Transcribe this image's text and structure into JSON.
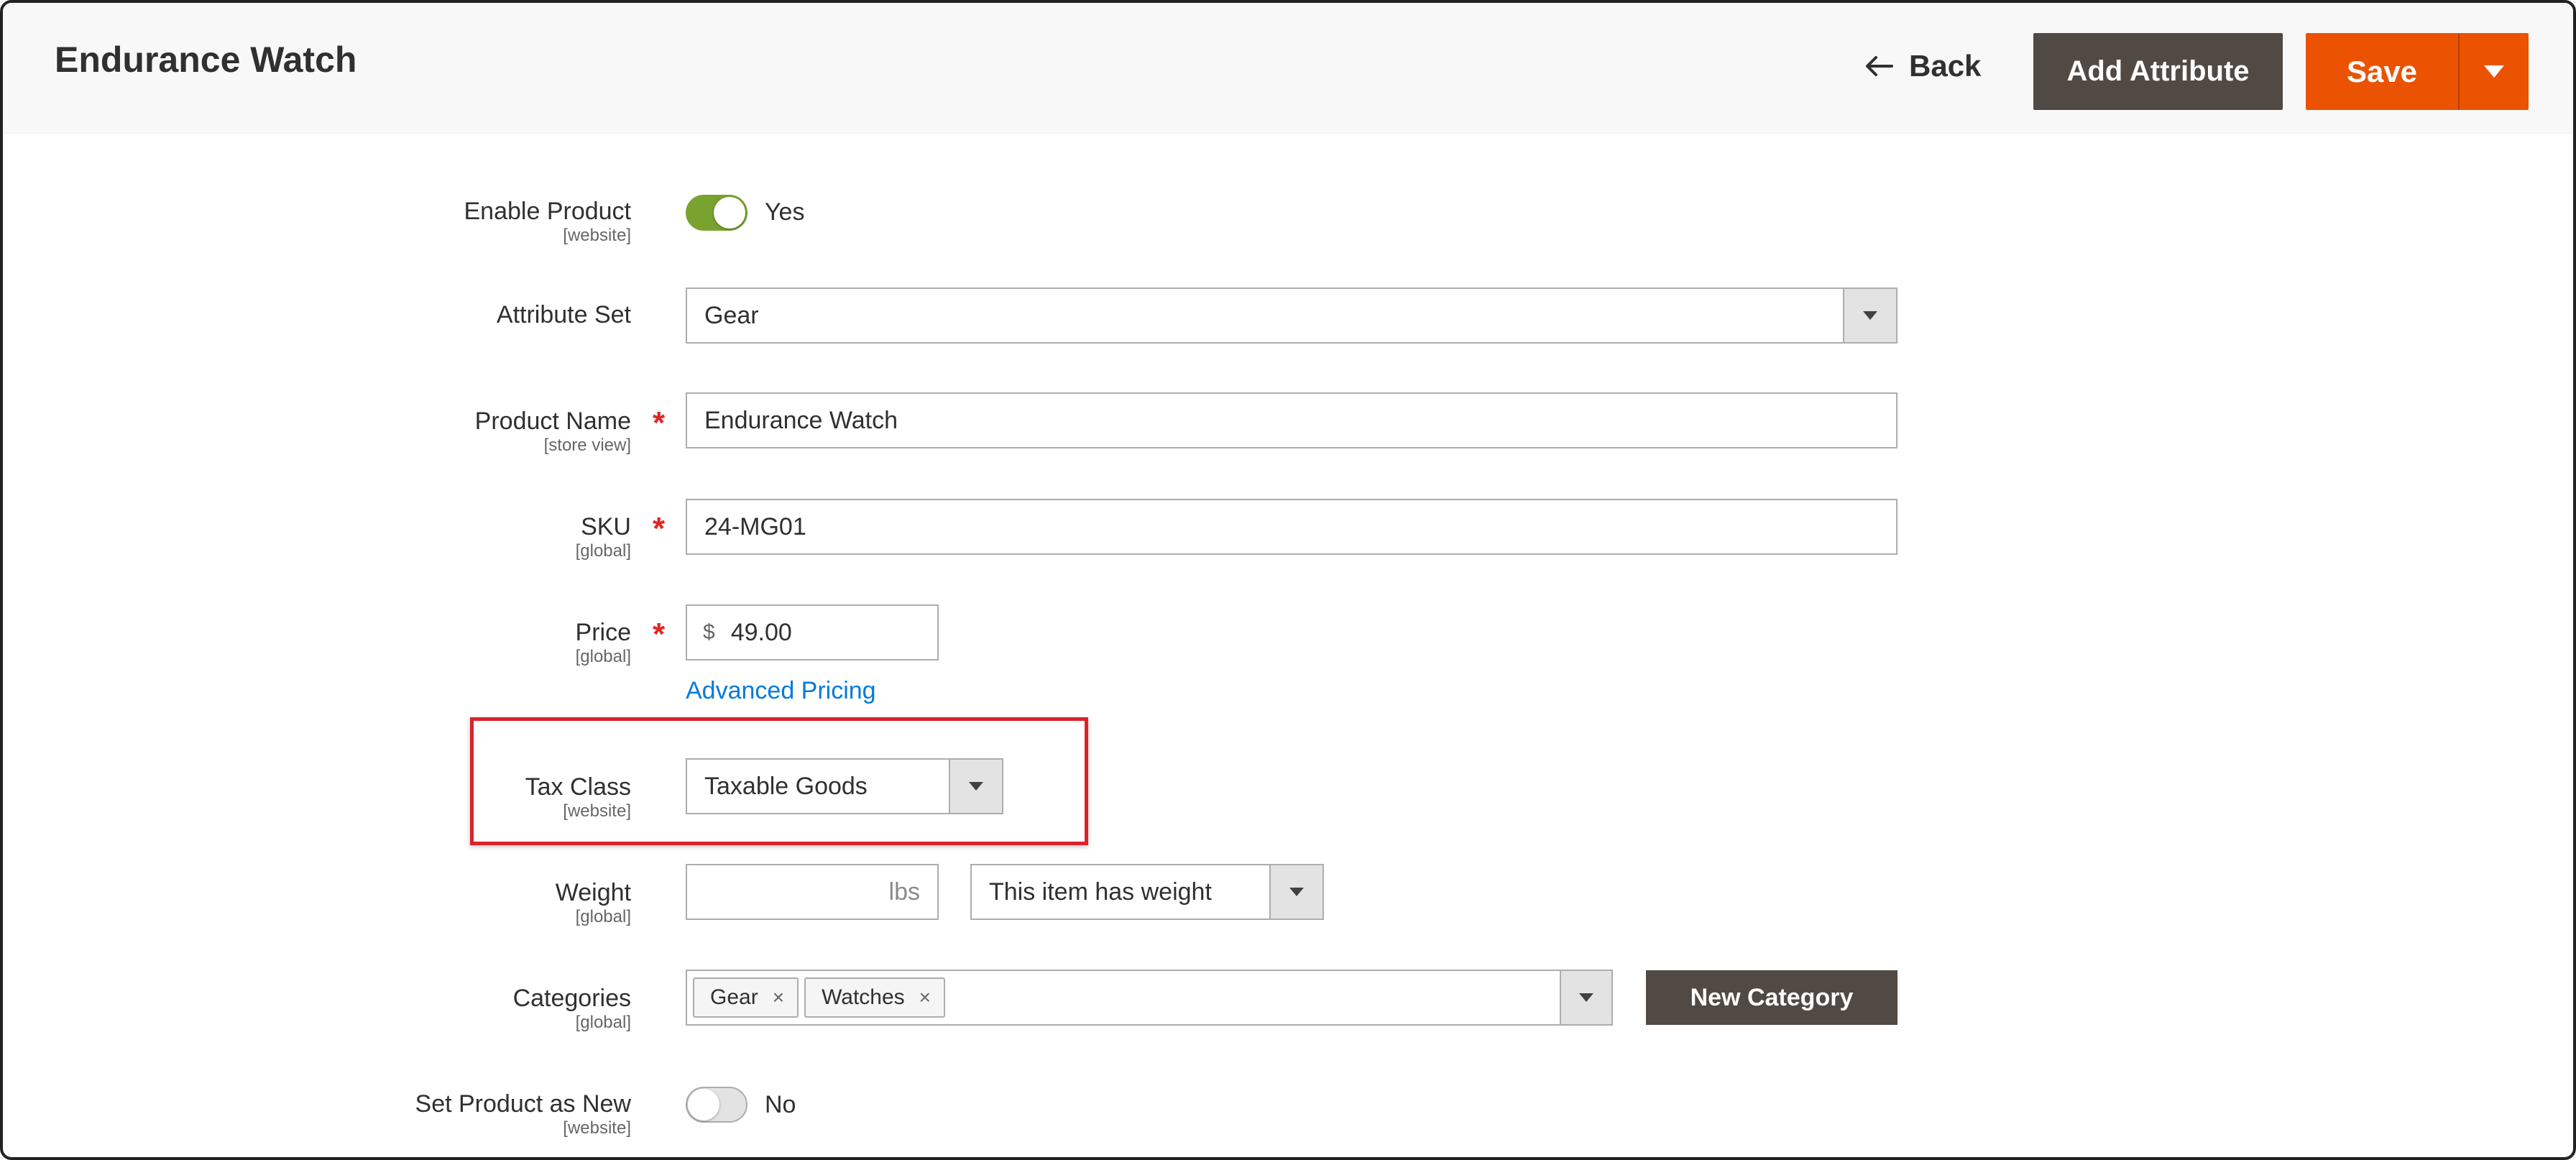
{
  "header": {
    "title": "Endurance Watch",
    "back_label": "Back",
    "add_attribute_label": "Add Attribute",
    "save_label": "Save"
  },
  "colors": {
    "primary_button": "#eb5202",
    "secondary_button": "#514943",
    "toggle_on": "#79a22e",
    "toggle_off": "#e3e3e3",
    "link": "#007bdb",
    "required": "#e22626",
    "highlight_border": "#d9232a"
  },
  "form": {
    "enable_product": {
      "label": "Enable Product",
      "scope": "[website]",
      "value": "Yes",
      "on": true
    },
    "attribute_set": {
      "label": "Attribute Set",
      "value": "Gear"
    },
    "product_name": {
      "label": "Product Name",
      "scope": "[store view]",
      "value": "Endurance Watch",
      "required": true
    },
    "sku": {
      "label": "SKU",
      "scope": "[global]",
      "value": "24-MG01",
      "required": true
    },
    "price": {
      "label": "Price",
      "scope": "[global]",
      "currency": "$",
      "value": "49.00",
      "required": true,
      "advanced_link": "Advanced Pricing"
    },
    "tax_class": {
      "label": "Tax Class",
      "scope": "[website]",
      "value": "Taxable Goods"
    },
    "weight": {
      "label": "Weight",
      "scope": "[global]",
      "unit": "lbs",
      "value": "",
      "type_value": "This item has weight"
    },
    "categories": {
      "label": "Categories",
      "scope": "[global]",
      "chips": [
        "Gear",
        "Watches"
      ],
      "new_button": "New Category"
    },
    "set_new": {
      "label": "Set Product as New",
      "scope": "[website]",
      "value": "No",
      "on": false
    },
    "required_mark": "*",
    "remove_glyph": "×"
  }
}
